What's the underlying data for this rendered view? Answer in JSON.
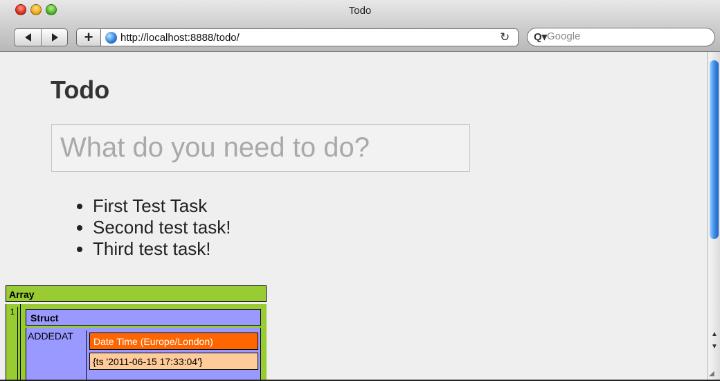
{
  "window": {
    "title": "Todo"
  },
  "toolbar": {
    "add_label": "+",
    "url": "http://localhost:8888/todo/",
    "reload_glyph": "↻",
    "search_placeholder": "Google",
    "search_icon": "Q▾"
  },
  "page": {
    "title": "Todo",
    "input_placeholder": "What do you need to do?",
    "tasks": [
      "First Test Task",
      "Second test task!",
      "Third test task!"
    ]
  },
  "dump": {
    "array_label": "Array",
    "index": "1",
    "struct_label": "Struct",
    "key": "ADDEDAT",
    "type_label": "Date Time (Europe/London)",
    "value": "{ts '2011-06-15 17:33:04'}"
  },
  "colors": {
    "array": "#99cc33",
    "struct": "#9999ff",
    "date_label": "#ff6600",
    "date_value": "#ffcc99"
  },
  "icons": [
    "close-icon",
    "minimize-icon",
    "zoom-icon",
    "back-arrow-icon",
    "forward-arrow-icon",
    "globe-icon",
    "reload-icon",
    "search-icon"
  ]
}
